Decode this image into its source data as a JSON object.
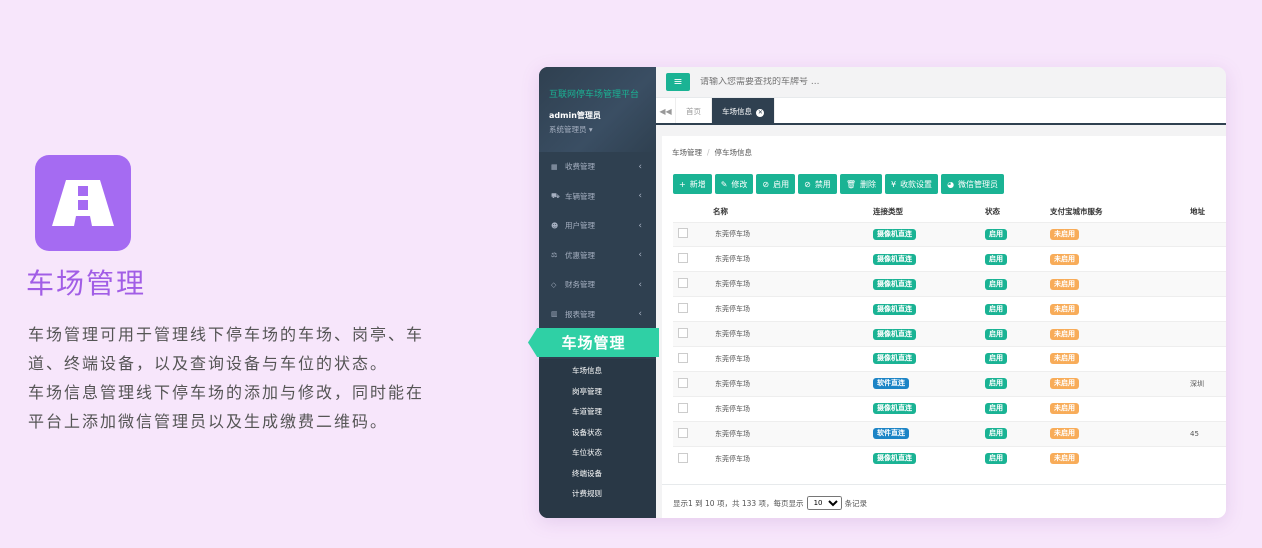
{
  "promo": {
    "title": "车场管理",
    "lines": [
      "车场管理可用于管理线下停车场的车场、岗亭、车",
      "道、终端设备，以及查询设备与车位的状态。",
      "车场信息管理线下停车场的添加与修改，同时能在",
      "平台上添加微信管理员以及生成缴费二维码。"
    ],
    "accent": "#a56bf2"
  },
  "sidebar": {
    "brand": "互联网停车场管理平台",
    "user": "admin管理员",
    "role": "系统管理员",
    "menu": [
      {
        "label": "收费管理",
        "icon": "grid-icon"
      },
      {
        "label": "车辆管理",
        "icon": "car-icon"
      },
      {
        "label": "用户管理",
        "icon": "users-icon"
      },
      {
        "label": "优惠管理",
        "icon": "balance-icon"
      },
      {
        "label": "财务管理",
        "icon": "diamond-icon"
      },
      {
        "label": "报表管理",
        "icon": "bar-chart-icon"
      }
    ],
    "active_group": "车场管理",
    "submenu": [
      "车场信息",
      "岗亭管理",
      "车道管理",
      "设备状态",
      "车位状态",
      "终端设备",
      "计费规则"
    ]
  },
  "topbar": {
    "search_placeholder": "请输入您需要查找的车牌号 ..."
  },
  "tabs": [
    {
      "label": "首页"
    },
    {
      "label": "车场信息"
    }
  ],
  "breadcrumb": {
    "parent": "车场管理",
    "separator": "/",
    "current": "停车场信息"
  },
  "toolbar": [
    {
      "label": "新增",
      "icon": "+"
    },
    {
      "label": "修改",
      "icon": "✎"
    },
    {
      "label": "启用",
      "icon": "⊘"
    },
    {
      "label": "禁用",
      "icon": "⊘"
    },
    {
      "label": "删除",
      "icon": "🗑"
    },
    {
      "label": "收款设置",
      "icon": "¥"
    },
    {
      "label": "微信管理员",
      "icon": "◕"
    }
  ],
  "table": {
    "headers": [
      "名称",
      "连接类型",
      "状态",
      "支付宝城市服务",
      "地址"
    ],
    "rows": [
      {
        "name": "东莞停车场",
        "conn": "摄像机直连",
        "conn_type": "camera",
        "status": "启用",
        "alipay": "未启用",
        "addr": ""
      },
      {
        "name": "东莞停车场",
        "conn": "摄像机直连",
        "conn_type": "camera",
        "status": "启用",
        "alipay": "未启用",
        "addr": ""
      },
      {
        "name": "东莞停车场",
        "conn": "摄像机直连",
        "conn_type": "camera",
        "status": "启用",
        "alipay": "未启用",
        "addr": ""
      },
      {
        "name": "东莞停车场",
        "conn": "摄像机直连",
        "conn_type": "camera",
        "status": "启用",
        "alipay": "未启用",
        "addr": ""
      },
      {
        "name": "东莞停车场",
        "conn": "摄像机直连",
        "conn_type": "camera",
        "status": "启用",
        "alipay": "未启用",
        "addr": ""
      },
      {
        "name": "东莞停车场",
        "conn": "摄像机直连",
        "conn_type": "camera",
        "status": "启用",
        "alipay": "未启用",
        "addr": ""
      },
      {
        "name": "东莞停车场",
        "conn": "软件直连",
        "conn_type": "software",
        "status": "启用",
        "alipay": "未启用",
        "addr": "深圳"
      },
      {
        "name": "东莞停车场",
        "conn": "摄像机直连",
        "conn_type": "camera",
        "status": "启用",
        "alipay": "未启用",
        "addr": ""
      },
      {
        "name": "东莞停车场",
        "conn": "软件直连",
        "conn_type": "software",
        "status": "启用",
        "alipay": "未启用",
        "addr": "45"
      },
      {
        "name": "东莞停车场",
        "conn": "摄像机直连",
        "conn_type": "camera",
        "status": "启用",
        "alipay": "未启用",
        "addr": ""
      }
    ]
  },
  "pager": {
    "prefix": "显示1 到 10 项，共 133 项，每页显示",
    "page_size": "10",
    "suffix": "条记录"
  },
  "colors": {
    "primary": "#1ab394",
    "sidebar": "#2f4050",
    "camera_badge": "#1ab394",
    "software_badge": "#1c84c6",
    "status_badge": "#1ab394",
    "alipay_badge": "#f8ac59"
  }
}
